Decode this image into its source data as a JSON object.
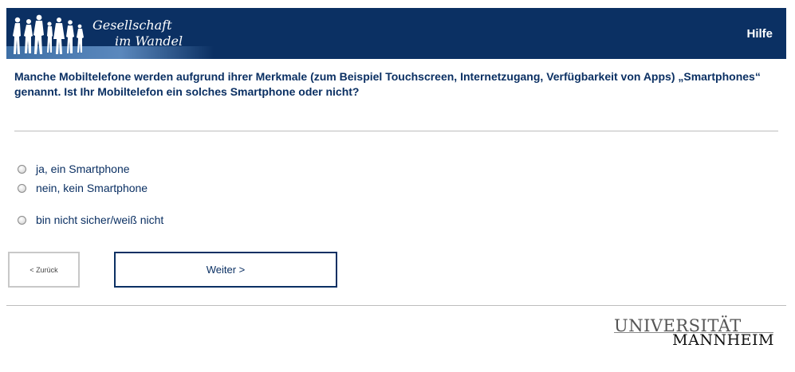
{
  "header": {
    "brand_line1": "Gesellschaft",
    "brand_line2": "im Wandel",
    "help_label": "Hilfe"
  },
  "question": {
    "text": "Manche Mobiltelefone werden aufgrund ihrer Merkmale (zum Beispiel Touchscreen, Internetzugang, Verfügbarkeit von Apps) „Smartphones“ genannt. Ist Ihr Mobiltelefon ein solches Smartphone oder nicht?"
  },
  "options": [
    {
      "label": "ja, ein Smartphone",
      "selected": false
    },
    {
      "label": "nein, kein Smartphone",
      "selected": false
    },
    {
      "label": "bin nicht sicher/weiß nicht",
      "selected": false
    }
  ],
  "nav": {
    "back_label": "< Zurück",
    "next_label": "Weiter >"
  },
  "footer": {
    "logo_line1": "UNIVERSITÄT",
    "logo_line2": "MANNHEIM"
  },
  "colors": {
    "brand_blue": "#0b3063",
    "rule_gray": "#bdbdbd"
  }
}
